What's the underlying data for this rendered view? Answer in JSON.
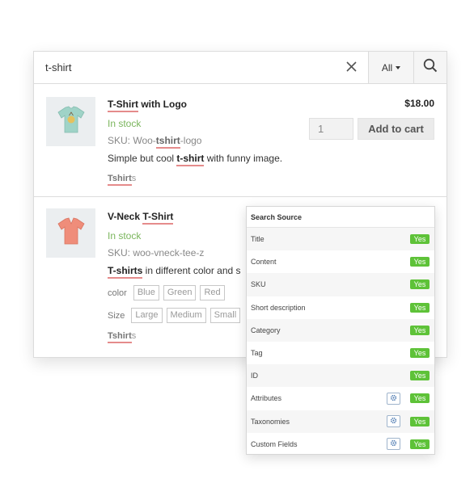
{
  "search": {
    "value": "t-shirt",
    "category": "All"
  },
  "results": [
    {
      "title_hl": "T-Shirt",
      "title_rest": " with Logo",
      "stock": "In stock",
      "sku_pre": "SKU: Woo-",
      "sku_hl": "tshirt",
      "sku_post": "-logo",
      "desc_pre": "Simple but cool ",
      "desc_hl": "t-shirt",
      "desc_post": " with funny image.",
      "tax_hl": "Tshirt",
      "tax_post": "s",
      "price": "$18.00",
      "qty": "1",
      "add_to_cart": "Add to cart"
    },
    {
      "title_pre": "V-Neck ",
      "title_hl": "T-Shirt",
      "stock": "In stock",
      "sku": "SKU: woo-vneck-tee-z",
      "desc_hl": "T-shirts",
      "desc_post": " in different color and s",
      "color_label": "color",
      "colors": [
        "Blue",
        "Green",
        "Red"
      ],
      "size_label": "Size",
      "sizes": [
        "Large",
        "Medium",
        "Small"
      ],
      "tax_hl": "Tshirt",
      "tax_post": "s"
    }
  ],
  "search_source": {
    "heading": "Search Source",
    "rows": [
      {
        "label": "Title",
        "status": "Yes"
      },
      {
        "label": "Content",
        "status": "Yes"
      },
      {
        "label": "SKU",
        "status": "Yes"
      },
      {
        "label": "Short description",
        "status": "Yes"
      },
      {
        "label": "Category",
        "status": "Yes"
      },
      {
        "label": "Tag",
        "status": "Yes"
      },
      {
        "label": "ID",
        "status": "Yes"
      },
      {
        "label": "Attributes",
        "status": "Yes",
        "settings": "gear-icon"
      },
      {
        "label": "Taxonomies",
        "status": "Yes",
        "settings": "gear-icon"
      },
      {
        "label": "Custom Fields",
        "status": "Yes",
        "settings": "gear-icon"
      }
    ]
  },
  "colors": {
    "stock": "#7ab55c",
    "highlight": "#e58b8b",
    "yes": "#5ec238",
    "tee_mint": "#9fd3c7",
    "tee_coral": "#ef8d7a"
  }
}
